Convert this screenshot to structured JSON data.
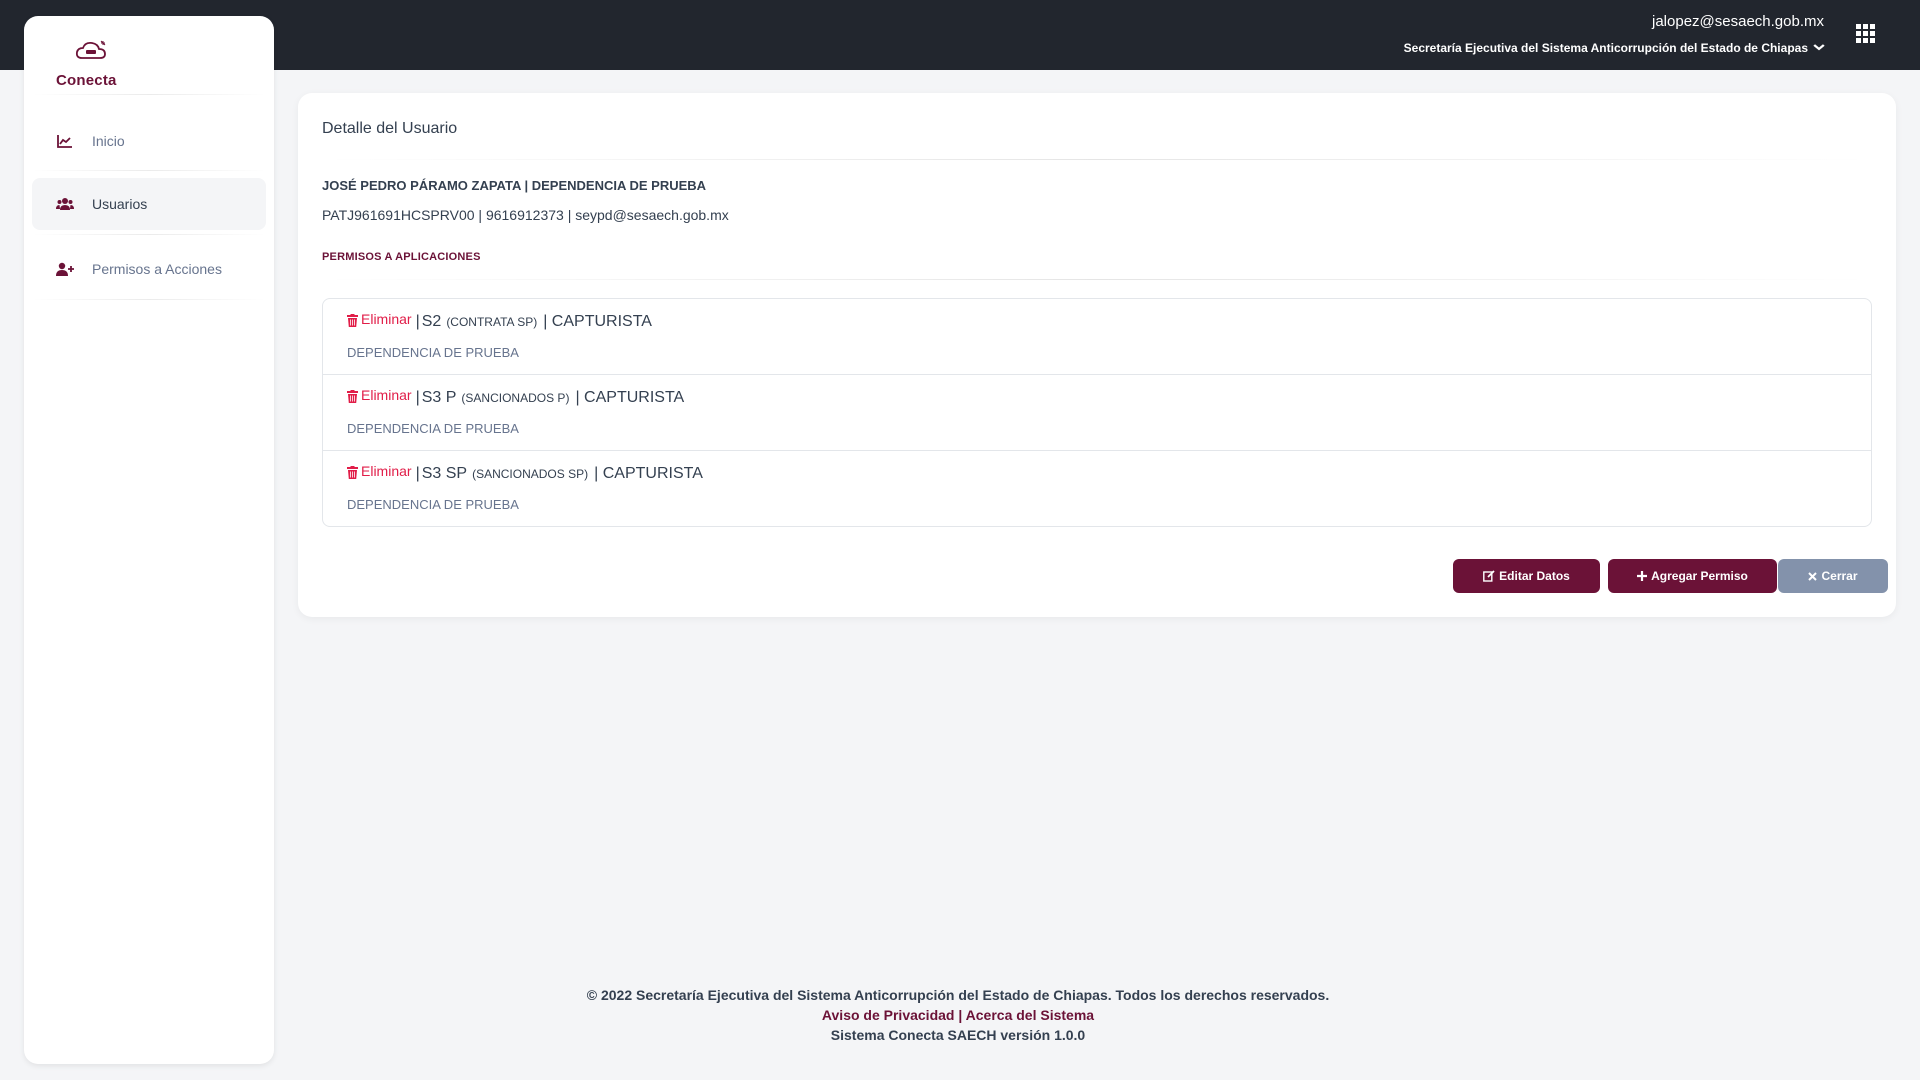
{
  "header": {
    "user_email": "jalopez@sesaech.gob.mx",
    "organization": "Secretaría Ejecutiva del Sistema Anticorrupción del Estado de Chiapas"
  },
  "sidebar": {
    "logo_text": "Conecta",
    "items": [
      {
        "label": "Inicio",
        "icon": "chart-line-icon",
        "active": false
      },
      {
        "label": "Usuarios",
        "icon": "users-icon",
        "active": true
      },
      {
        "label": "Permisos a Acciones",
        "icon": "user-plus-icon",
        "active": false
      }
    ]
  },
  "detail": {
    "title": "Detalle del Usuario",
    "name_line": "JOSÉ PEDRO PÁRAMO ZAPATA | DEPENDENCIA DE PRUEBA",
    "info_line": "PATJ961691HCSPRV00 | 9616912373 | seypd@sesaech.gob.mx",
    "permissions_heading": "PERMISOS A APLICACIONES",
    "permissions": [
      {
        "delete_label": "Eliminar",
        "app_code": "S2",
        "app_name": "(CONTRATA SP)",
        "role": "| CAPTURISTA",
        "dependency": "DEPENDENCIA DE PRUEBA"
      },
      {
        "delete_label": "Eliminar",
        "app_code": "S3 P",
        "app_name": "(SANCIONADOS P)",
        "role": "| CAPTURISTA",
        "dependency": "DEPENDENCIA DE PRUEBA"
      },
      {
        "delete_label": "Eliminar",
        "app_code": "S3 SP",
        "app_name": "(SANCIONADOS SP)",
        "role": "| CAPTURISTA",
        "dependency": "DEPENDENCIA DE PRUEBA"
      }
    ],
    "buttons": {
      "edit": "Editar Datos",
      "add": "Agregar Permiso",
      "close": "Cerrar"
    }
  },
  "footer": {
    "copyright": "© 2022 Secretaría Ejecutiva del Sistema Anticorrupción del Estado de Chiapas. Todos los derechos reservados.",
    "privacy_link": "Aviso de Privacidad",
    "separator": "|",
    "about_link": "Acerca del Sistema",
    "version": "Sistema Conecta SAECH versión 1.0.0"
  },
  "colors": {
    "brand": "#6b1237",
    "header_bg": "#22262e",
    "danger": "#e11d48",
    "secondary_button": "#8392ab"
  }
}
